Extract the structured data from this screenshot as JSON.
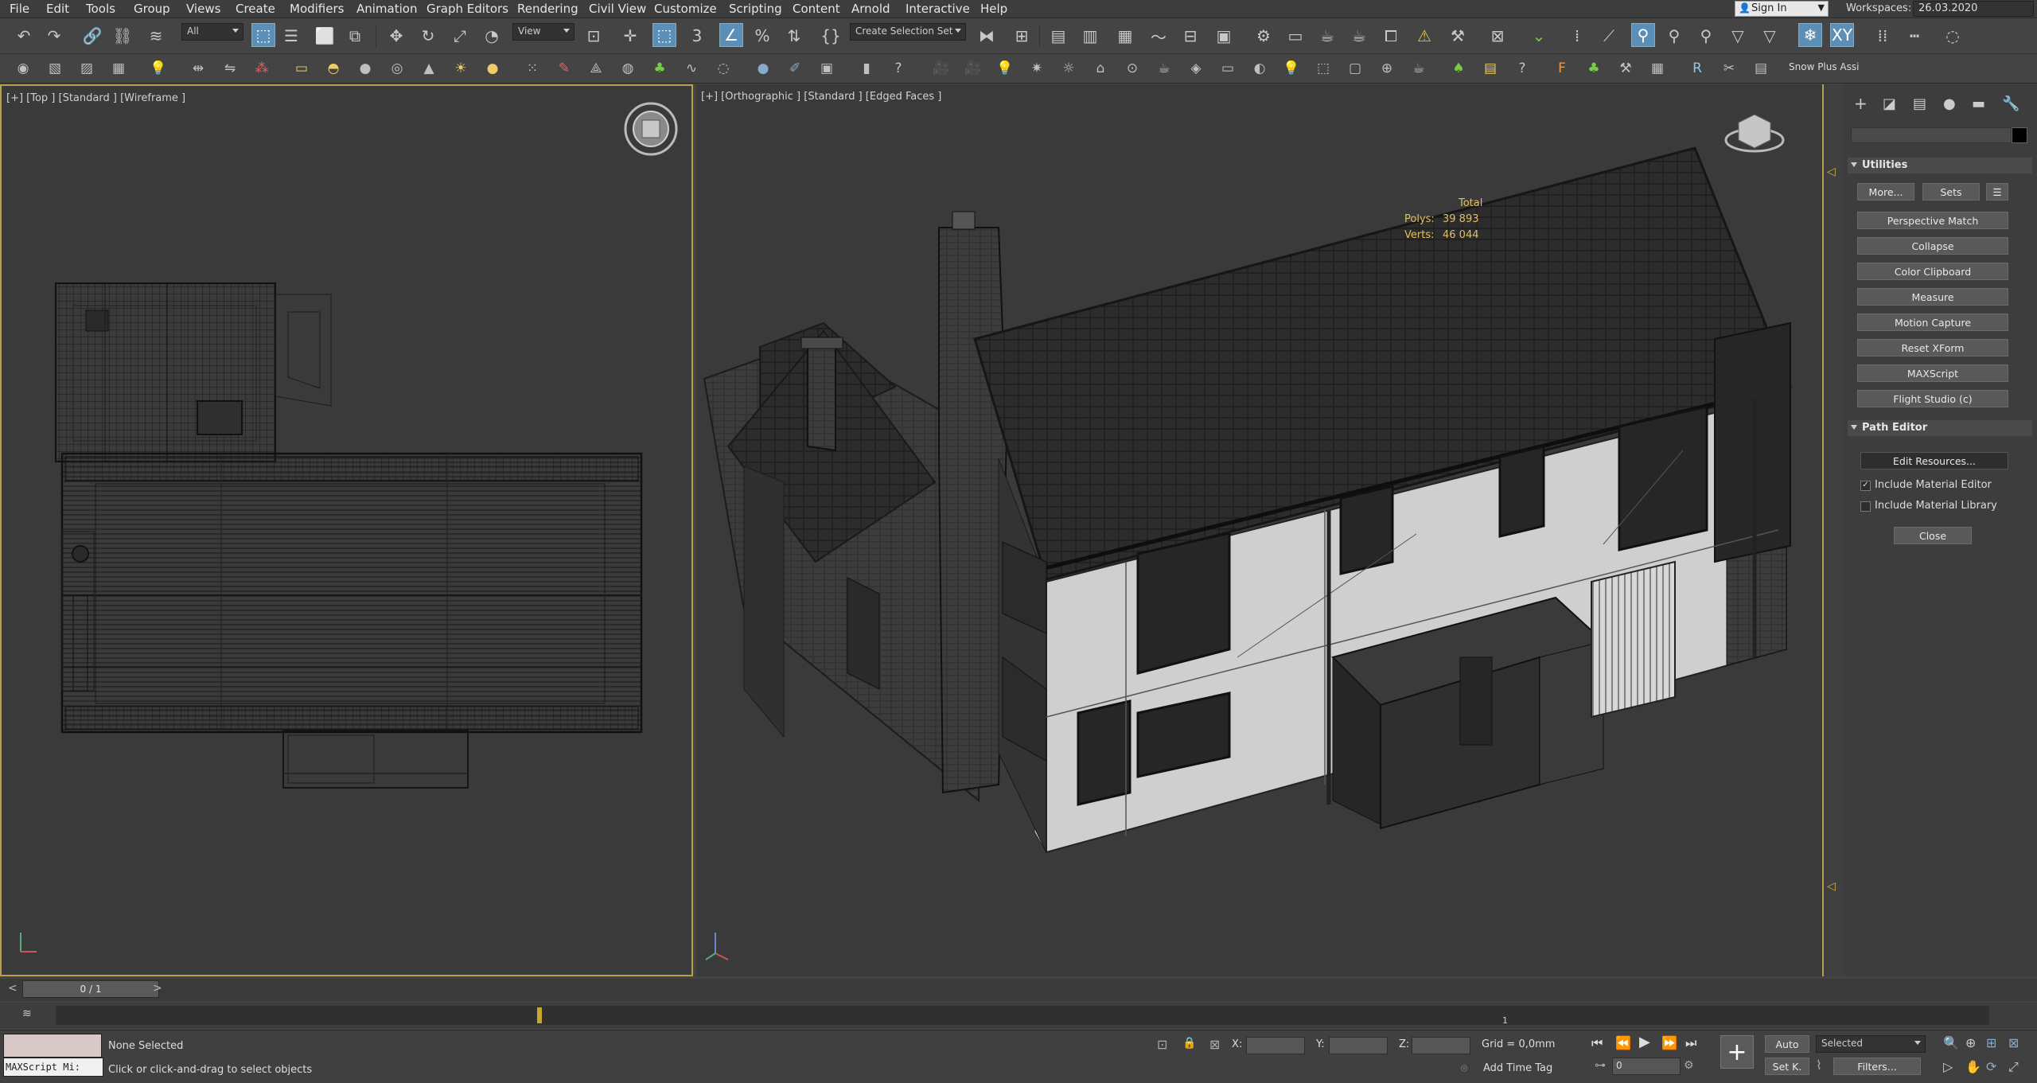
{
  "menu": [
    "File",
    "Edit",
    "Tools",
    "Group",
    "Views",
    "Create",
    "Modifiers",
    "Animation",
    "Graph Editors",
    "Rendering",
    "Civil View",
    "Customize",
    "Scripting",
    "Content",
    "Arnold",
    "Interactive",
    "Help"
  ],
  "signin_label": "Sign In",
  "workspace": {
    "label": "Workspaces:",
    "value": "26.03.2020"
  },
  "toolbar": {
    "filter_value": "All",
    "refcoord_value": "View",
    "selection_set_value": "Create Selection Set",
    "snow_plus_label": "Snow Plus Assi"
  },
  "viewports": {
    "left_label": "[+] [Top ] [Standard ] [Wireframe ]",
    "right_label": "[+] [Orthographic ] [Standard ] [Edged Faces ]",
    "stats": {
      "header": "Total",
      "polys_label": "Polys:",
      "polys": "39 893",
      "verts_label": "Verts:",
      "verts": "46 044"
    }
  },
  "command_panel": {
    "utilities_title": "Utilities",
    "more_label": "More...",
    "sets_label": "Sets",
    "utility_buttons": [
      "Perspective Match",
      "Collapse",
      "Color Clipboard",
      "Measure",
      "Motion Capture",
      "Reset XForm",
      "MAXScript",
      "Flight Studio (c)"
    ],
    "path_editor_title": "Path Editor",
    "edit_resources_label": "Edit Resources...",
    "include_material_editor": {
      "label": "Include Material Editor",
      "checked": true
    },
    "include_material_library": {
      "label": "Include Material Library",
      "checked": false
    },
    "close_label": "Close"
  },
  "timeline": {
    "frame_counter": "0 / 1",
    "track_tick_label": "1"
  },
  "status": {
    "maxscript_placeholder": "MAXScript Mi:",
    "selection_text": "None Selected",
    "prompt_text": "Click or click-and-drag to select objects",
    "x_label": "X:",
    "y_label": "Y:",
    "z_label": "Z:",
    "grid_text": "Grid = 0,0mm",
    "add_time_tag": "Add Time Tag",
    "auto_label": "Auto",
    "selected_value": "Selected",
    "setk_label": "Set K.",
    "filters_label": "Filters...",
    "frame_field": "0"
  }
}
